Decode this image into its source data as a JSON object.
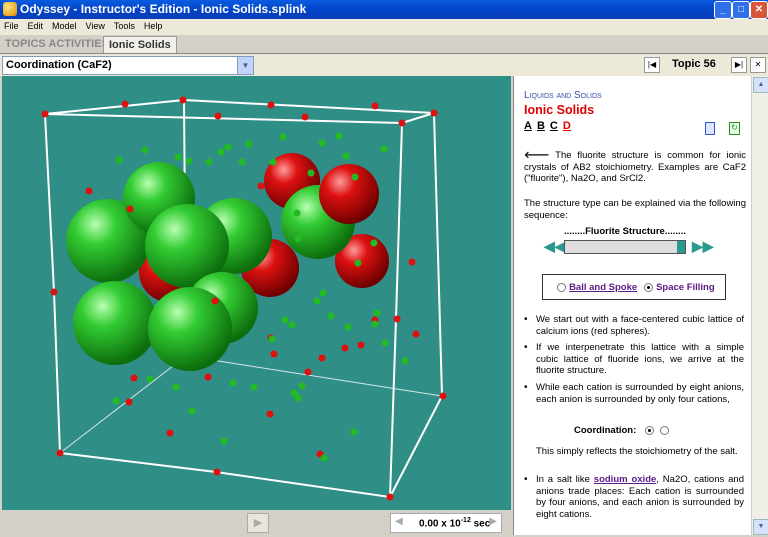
{
  "window": {
    "title": "Odyssey - Instructor's Edition - Ionic Solids.splink"
  },
  "menu": [
    "File",
    "Edit",
    "Model",
    "View",
    "Tools",
    "Help"
  ],
  "tabs": {
    "topics_activities": "TOPICS ACTIVITIES",
    "active": "Ionic Solids"
  },
  "selector": {
    "value": "Coordination (CaF2)"
  },
  "topic_nav": {
    "label": "Topic 56",
    "first": "|◀",
    "last": "▶|",
    "close": "✕"
  },
  "bottom": {
    "play": "▶",
    "time_value": "0.00 x 10",
    "time_exp": "-12",
    "time_unit": "sec"
  },
  "panel": {
    "category": "Liquids and Solids",
    "heading": "Ionic Solids",
    "letters": [
      "A",
      "B",
      "C",
      "D"
    ],
    "intro_p1": "The fluorite structure is common for ionic crystals of AB2 stoichiometry. Examples are CaF2 (\"fluorite\"), Na2O, and SrCl2.",
    "intro_p2": "The structure type can be explained via the following sequence:",
    "sequence_label": "........Fluorite Structure........",
    "options": {
      "ball_spoke": "Ball and Spoke",
      "space_filling": "Space Filling"
    },
    "bullet1": "We start out with a face-centered cubic lattice of calcium ions (red spheres).",
    "bullet2": "If we interpenetrate this lattice with a simple cubic lattice of fluoride ions, we arrive at the fluorite structure.",
    "bullet3": "While each cation is surrounded by eight anions, each anion is surrounded by only four cations,",
    "coordination_label": "Coordination:",
    "reflects": "This simply reflects the stoichiometry of the salt.",
    "bullet4_pre": "In a salt like ",
    "bullet4_link": "sodium oxide",
    "bullet4_post": ", Na2O, cations and anions trade places: Each cation is surrounded by four anions, and each anion is surrounded by eight cations."
  },
  "colors": {
    "viewer_bg": "#2f8e86",
    "cation": "#cc1010",
    "anion": "#22aa22",
    "accent_red": "#e00000",
    "link": "#5a1a86"
  }
}
